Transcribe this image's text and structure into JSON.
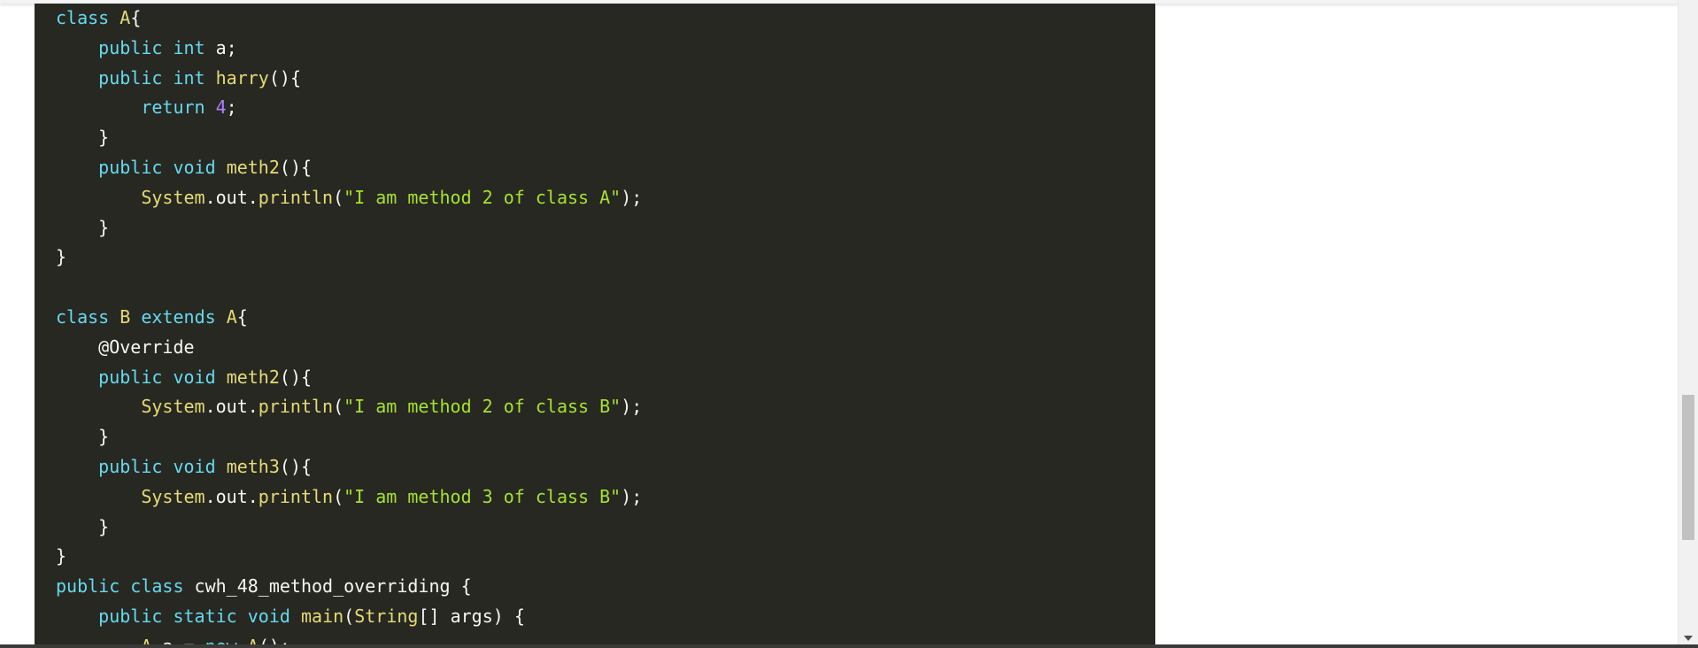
{
  "code": {
    "lines": [
      [
        {
          "t": "class",
          "c": "keyword"
        },
        {
          "t": " "
        },
        {
          "t": "A",
          "c": "class"
        },
        {
          "t": "{"
        }
      ],
      [
        {
          "t": "    "
        },
        {
          "t": "public",
          "c": "keyword"
        },
        {
          "t": " "
        },
        {
          "t": "int",
          "c": "keyword"
        },
        {
          "t": " a;"
        }
      ],
      [
        {
          "t": "    "
        },
        {
          "t": "public",
          "c": "keyword"
        },
        {
          "t": " "
        },
        {
          "t": "int",
          "c": "keyword"
        },
        {
          "t": " "
        },
        {
          "t": "harry",
          "c": "function"
        },
        {
          "t": "(){"
        }
      ],
      [
        {
          "t": "        "
        },
        {
          "t": "return",
          "c": "keyword"
        },
        {
          "t": " "
        },
        {
          "t": "4",
          "c": "number"
        },
        {
          "t": ";"
        }
      ],
      [
        {
          "t": "    }"
        }
      ],
      [
        {
          "t": "    "
        },
        {
          "t": "public",
          "c": "keyword"
        },
        {
          "t": " "
        },
        {
          "t": "void",
          "c": "keyword"
        },
        {
          "t": " "
        },
        {
          "t": "meth2",
          "c": "function"
        },
        {
          "t": "(){"
        }
      ],
      [
        {
          "t": "        "
        },
        {
          "t": "System",
          "c": "class"
        },
        {
          "t": ".out."
        },
        {
          "t": "println",
          "c": "function"
        },
        {
          "t": "("
        },
        {
          "t": "\"I am method 2 of class A\"",
          "c": "string"
        },
        {
          "t": ");"
        }
      ],
      [
        {
          "t": "    }"
        }
      ],
      [
        {
          "t": "}"
        }
      ],
      [
        {
          "t": ""
        }
      ],
      [
        {
          "t": "class",
          "c": "keyword"
        },
        {
          "t": " "
        },
        {
          "t": "B",
          "c": "class"
        },
        {
          "t": " "
        },
        {
          "t": "extends",
          "c": "keyword"
        },
        {
          "t": " "
        },
        {
          "t": "A",
          "c": "class"
        },
        {
          "t": "{"
        }
      ],
      [
        {
          "t": "    "
        },
        {
          "t": "@Override",
          "c": "annotation"
        }
      ],
      [
        {
          "t": "    "
        },
        {
          "t": "public",
          "c": "keyword"
        },
        {
          "t": " "
        },
        {
          "t": "void",
          "c": "keyword"
        },
        {
          "t": " "
        },
        {
          "t": "meth2",
          "c": "function"
        },
        {
          "t": "(){"
        }
      ],
      [
        {
          "t": "        "
        },
        {
          "t": "System",
          "c": "class"
        },
        {
          "t": ".out."
        },
        {
          "t": "println",
          "c": "function"
        },
        {
          "t": "("
        },
        {
          "t": "\"I am method 2 of class B\"",
          "c": "string"
        },
        {
          "t": ");"
        }
      ],
      [
        {
          "t": "    }"
        }
      ],
      [
        {
          "t": "    "
        },
        {
          "t": "public",
          "c": "keyword"
        },
        {
          "t": " "
        },
        {
          "t": "void",
          "c": "keyword"
        },
        {
          "t": " "
        },
        {
          "t": "meth3",
          "c": "function"
        },
        {
          "t": "(){"
        }
      ],
      [
        {
          "t": "        "
        },
        {
          "t": "System",
          "c": "class"
        },
        {
          "t": ".out."
        },
        {
          "t": "println",
          "c": "function"
        },
        {
          "t": "("
        },
        {
          "t": "\"I am method 3 of class B\"",
          "c": "string"
        },
        {
          "t": ");"
        }
      ],
      [
        {
          "t": "    }"
        }
      ],
      [
        {
          "t": "}"
        }
      ],
      [
        {
          "t": "public",
          "c": "keyword"
        },
        {
          "t": " "
        },
        {
          "t": "class",
          "c": "keyword"
        },
        {
          "t": " cwh_48_method_overriding {"
        }
      ],
      [
        {
          "t": "    "
        },
        {
          "t": "public",
          "c": "keyword"
        },
        {
          "t": " "
        },
        {
          "t": "static",
          "c": "keyword"
        },
        {
          "t": " "
        },
        {
          "t": "void",
          "c": "keyword"
        },
        {
          "t": " "
        },
        {
          "t": "main",
          "c": "function"
        },
        {
          "t": "("
        },
        {
          "t": "String",
          "c": "class"
        },
        {
          "t": "[] args) {"
        }
      ],
      [
        {
          "t": "        "
        },
        {
          "t": "A",
          "c": "class"
        },
        {
          "t": " a = "
        },
        {
          "t": "new",
          "c": "keyword"
        },
        {
          "t": " "
        },
        {
          "t": "A",
          "c": "class"
        },
        {
          "t": "();"
        }
      ]
    ]
  },
  "colors": {
    "code_background": "#272822",
    "keyword": "#66d9ef",
    "class": "#e6db74",
    "string": "#a6e22e",
    "number": "#ae81ff",
    "plain": "#f8f8f2"
  },
  "icons": {
    "scroll_down": "chevron-down-icon"
  }
}
